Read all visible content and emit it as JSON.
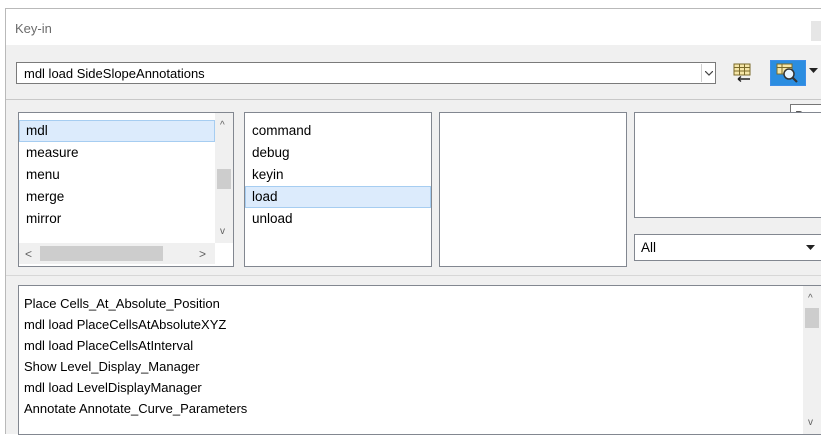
{
  "window": {
    "title": "Key-in",
    "close_label": "×"
  },
  "keyin": {
    "value": "mdl load SideSlopeAnnotations"
  },
  "toolbar": {
    "key_in_icon": "keyin-history-icon",
    "browse_icon": "browse-magnifier-icon",
    "tooltip": "Browse",
    "accent": "#2b8de0"
  },
  "lists": {
    "list1": {
      "items": [
        "mdl",
        "measure",
        "menu",
        "merge",
        "mirror"
      ],
      "selected": "mdl"
    },
    "list2": {
      "items": [
        "command",
        "debug",
        "keyin",
        "load",
        "unload"
      ],
      "selected": "load"
    },
    "list3": {
      "items": []
    },
    "list4": {
      "items": []
    }
  },
  "filter": {
    "selected": "All"
  },
  "history": {
    "items": [
      "Place Cells_At_Absolute_Position",
      "mdl load PlaceCellsAtAbsoluteXYZ",
      "mdl load PlaceCellsAtInterval",
      "Show Level_Display_Manager",
      "mdl load LevelDisplayManager",
      "Annotate Annotate_Curve_Parameters"
    ]
  }
}
